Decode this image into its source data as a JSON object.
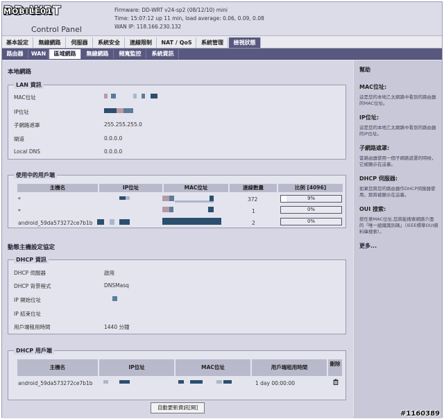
{
  "header": {
    "logo_brand": "MOBILE01",
    "logo_main": "DD-WRT",
    "logo_sub": "Control Panel",
    "firmware": "Firmware: DD-WRT v24-sp2 (08/12/10) mini",
    "time": "Time: 15:07:12 up 11 min, load average: 0.06, 0.09, 0.08",
    "wan_ip": "WAN IP: 118.166.230.132"
  },
  "menu_main": [
    "基本設定",
    "無線網路",
    "伺服器",
    "系統安全",
    "連線限制",
    "NAT / QoS",
    "系統管理",
    "檢視狀態"
  ],
  "menu_sub": [
    "路由器",
    "WAN",
    "區域網路",
    "無線網路",
    "頻寬監控",
    "系統資訊"
  ],
  "page": {
    "title": "本地網路",
    "lan": {
      "legend": "LAN 資訊",
      "mac_label": "MAC位址",
      "ip_label": "IP位址",
      "mask_label": "子網路遮罩",
      "mask_value": "255.255.255.0",
      "gw_label": "閘道",
      "gw_value": "0.0.0.0",
      "dns_label": "Local DNS",
      "dns_value": "0.0.0.0"
    },
    "clients": {
      "legend": "使用中的用戶端",
      "headers": [
        "主機名",
        "IP位址",
        "MAC位址",
        "連線數量",
        "比例 [4096]"
      ],
      "rows": [
        {
          "host": "*",
          "conns": "372",
          "ratio_text": "9%",
          "ratio": 0.09
        },
        {
          "host": "*",
          "conns": "1",
          "ratio_text": "0%",
          "ratio": 0.0
        },
        {
          "host": "android_59da573272ce7b1b",
          "conns": "2",
          "ratio_text": "0%",
          "ratio": 0.0
        }
      ]
    },
    "dhcp_title": "動態主機設定協定",
    "dhcp": {
      "legend": "DHCP 資訊",
      "server_label": "DHCP 伺服器",
      "server_value": "啟用",
      "daemon_label": "DHCP 背景程式",
      "daemon_value": "DNSMasq",
      "start_label": "IP 開始位址",
      "end_label": "IP 結束位址",
      "lease_label": "用戶端租用時間",
      "lease_value": "1440 分鐘"
    },
    "dhcp_clients": {
      "legend": "DHCP 用戶端",
      "headers": [
        "主機名",
        "IP位址",
        "MAC位址",
        "用戶端租用時間",
        "刪除"
      ],
      "rows": [
        {
          "host": "android_59da573272ce7b1b",
          "lease": "1 day 00:00:00"
        }
      ]
    },
    "refresh_button": "自動更新資訊[開]"
  },
  "help": {
    "title": "幫助",
    "items": [
      {
        "h": "MAC位址:",
        "p": "這是您的本地乙太網路中看到的路由器的MAC位址。"
      },
      {
        "h": "IP位址:",
        "p": "這是您的本地乙太網路中看到的路由器的IP位址。"
      },
      {
        "h": "子網路遮罩:",
        "p": "當路由器使用一個子網路遮罩的時候，它被顯示在這裏。"
      },
      {
        "h": "DHCP 伺服器:",
        "p": "如果您將您的路由器作DHCP伺服器使用，那將被顯示在這裏。"
      },
      {
        "h": "OUI 搜索:",
        "p": "按任意MAC位址,您將能搜索網路介面的「唯一組織識別碼」（IEEE標準OUI資料庫搜索）。"
      }
    ],
    "more": "更多..."
  },
  "watermark": "#1160389"
}
